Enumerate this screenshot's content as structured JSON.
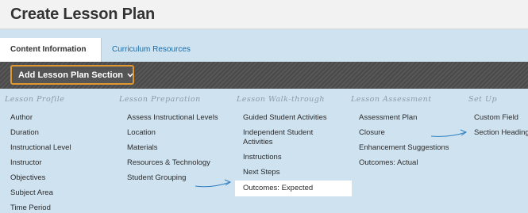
{
  "page": {
    "title": "Create Lesson Plan"
  },
  "tabs": [
    {
      "label": "Content Information",
      "active": true
    },
    {
      "label": "Curriculum Resources",
      "active": false
    }
  ],
  "action_bar": {
    "add_button_label": "Add Lesson Plan Section",
    "chevron_icon": "chevron-down-icon"
  },
  "menu": {
    "columns": [
      {
        "heading": "Lesson Profile",
        "items": [
          "Author",
          "Duration",
          "Instructional Level",
          "Instructor",
          "Objectives",
          "Subject Area",
          "Time Period"
        ]
      },
      {
        "heading": "Lesson Preparation",
        "items": [
          "Assess Instructional Levels",
          "Location",
          "Materials",
          "Resources & Technology",
          "Student Grouping"
        ]
      },
      {
        "heading": "Lesson Walk-through",
        "items": [
          "Guided Student Activities",
          "Independent Student Activities",
          "Instructions",
          "Next Steps",
          "Outcomes: Expected"
        ]
      },
      {
        "heading": "Lesson Assessment",
        "items": [
          "Assessment Plan",
          "Closure",
          "Enhancement Suggestions",
          "Outcomes: Actual"
        ]
      },
      {
        "heading": "Set Up",
        "items": [
          "Custom Field",
          "Section Heading"
        ]
      }
    ],
    "highlighted_item": "Outcomes: Expected"
  },
  "colors": {
    "menu_background": "#cfe2f0",
    "action_bar": "#4e4e4e",
    "button_outline": "#e0972f",
    "arrow": "#2f7fc0",
    "link": "#1a6ba3"
  }
}
